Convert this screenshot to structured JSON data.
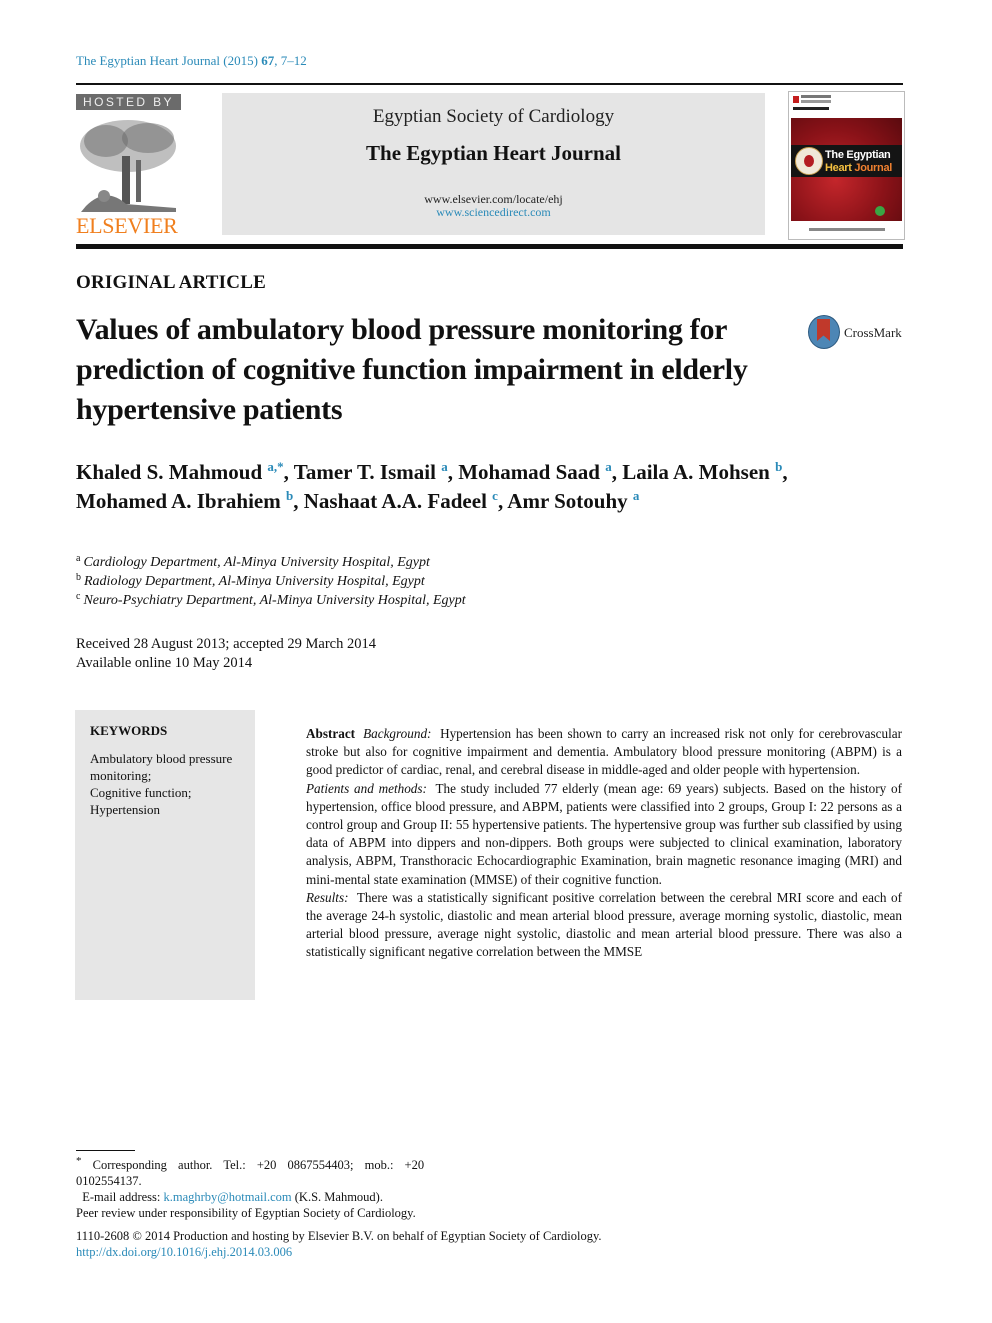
{
  "journal_citation": {
    "text_prefix": "The Egyptian Heart Journal (2015) ",
    "volume": "67",
    "pages": ", 7–12"
  },
  "header": {
    "hosted_by": "HOSTED BY",
    "publisher_logo_text": "ELSEVIER",
    "society": "Egyptian Society of Cardiology",
    "journal_title": "The Egyptian Heart Journal",
    "url_journal": "www.elsevier.com/locate/ehj",
    "url_sciencedirect": "www.sciencedirect.com",
    "cover_title_line1": "The Egyptian",
    "cover_title_line2a": "Heart ",
    "cover_title_line2b": "Journal"
  },
  "article": {
    "type": "ORIGINAL ARTICLE",
    "title": "Values of ambulatory blood pressure monitoring for prediction of cognitive function impairment in elderly hypertensive patients",
    "crossmark_label": "CrossMark",
    "authors": [
      {
        "name": "Khaled S. Mahmoud",
        "sup": "a,*",
        "sep": ", "
      },
      {
        "name": "Tamer T. Ismail",
        "sup": "a",
        "sep": ", "
      },
      {
        "name": "Mohamad Saad",
        "sup": "a",
        "sep": ", "
      },
      {
        "name": "Laila A. Mohsen",
        "sup": "b",
        "sep": ","
      },
      {
        "name": "Mohamed A. Ibrahiem",
        "sup": "b",
        "sep": ", "
      },
      {
        "name": "Nashaat A.A. Fadeel",
        "sup": "c",
        "sep": ", "
      },
      {
        "name": "Amr Sotouhy",
        "sup": "a",
        "sep": ""
      }
    ],
    "affiliations": [
      {
        "key": "a",
        "text": "Cardiology Department, Al-Minya University Hospital, Egypt"
      },
      {
        "key": "b",
        "text": "Radiology Department, Al-Minya University Hospital, Egypt"
      },
      {
        "key": "c",
        "text": "Neuro-Psychiatry Department, Al-Minya University Hospital, Egypt"
      }
    ],
    "received": "Received 28 August 2013; accepted 29 March 2014",
    "available": "Available online 10 May 2014"
  },
  "keywords": {
    "heading": "KEYWORDS",
    "items": [
      "Ambulatory blood pressure monitoring;",
      "Cognitive function;",
      "Hypertension"
    ]
  },
  "abstract": {
    "lead": "Abstract",
    "sections": [
      {
        "label": "Background:",
        "text": "Hypertension has been shown to carry an increased risk not only for cerebrovascular stroke but also for cognitive impairment and dementia. Ambulatory blood pressure monitoring (ABPM) is a good predictor of cardiac, renal, and cerebral disease in middle-aged and older people with hypertension."
      },
      {
        "label": "Patients and methods:",
        "text": "The study included 77 elderly (mean age: 69 years) subjects. Based on the history of hypertension, office blood pressure, and ABPM, patients were classified into 2 groups, Group I: 22 persons as a control group and Group II: 55 hypertensive patients. The hypertensive group was further sub classified by using data of ABPM into dippers and non-dippers. Both groups were subjected to clinical examination, laboratory analysis, ABPM, Transthoracic Echocardiographic Examination, brain magnetic resonance imaging (MRI) and mini-mental state examination (MMSE) of their cognitive function."
      },
      {
        "label": "Results:",
        "text": "There was a statistically significant positive correlation between the cerebral MRI score and each of the average 24-h systolic, diastolic and mean arterial blood pressure, average morning systolic, diastolic, mean arterial blood pressure, average night systolic, diastolic and mean arterial blood pressure. There was also a statistically significant negative correlation between the MMSE"
      }
    ]
  },
  "footnotes": {
    "corresponding_mark": "*",
    "corresponding": "Corresponding author. Tel.: +20 0867554403; mob.: +20 0102554137.",
    "email_label": "E-mail address: ",
    "email": "k.maghrby@hotmail.com",
    "email_suffix": " (K.S. Mahmoud).",
    "peer_review": "Peer review under responsibility of Egyptian Society of Cardiology.",
    "copyright": "1110-2608 © 2014 Production and hosting by Elsevier B.V. on behalf of Egyptian Society of Cardiology.",
    "doi": "http://dx.doi.org/10.1016/j.ehj.2014.03.006"
  }
}
